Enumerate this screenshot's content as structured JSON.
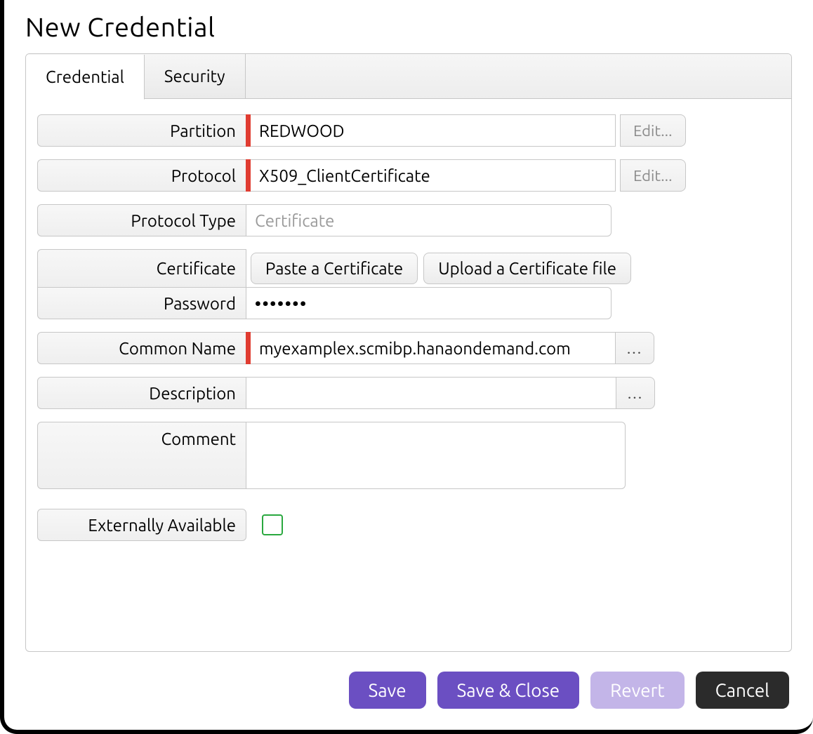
{
  "title": "New Credential",
  "tabs": [
    {
      "label": "Credential",
      "active": true
    },
    {
      "label": "Security",
      "active": false
    }
  ],
  "labels": {
    "partition": "Partition",
    "protocol": "Protocol",
    "protocol_type": "Protocol Type",
    "certificate": "Certificate",
    "password": "Password",
    "common_name": "Common Name",
    "description": "Description",
    "comment": "Comment",
    "externally_available": "Externally Available"
  },
  "values": {
    "partition": "REDWOOD",
    "protocol": "X509_ClientCertificate",
    "protocol_type_placeholder": "Certificate",
    "password": "•••••••",
    "common_name": "myexamplex.scmibp.hanaondemand.com",
    "description": "",
    "comment": "",
    "externally_available": false
  },
  "buttons": {
    "edit": "Edit...",
    "paste_cert": "Paste a Certificate",
    "upload_cert": "Upload a Certificate file",
    "ellipsis": "...",
    "save": "Save",
    "save_close": "Save & Close",
    "revert": "Revert",
    "cancel": "Cancel"
  }
}
